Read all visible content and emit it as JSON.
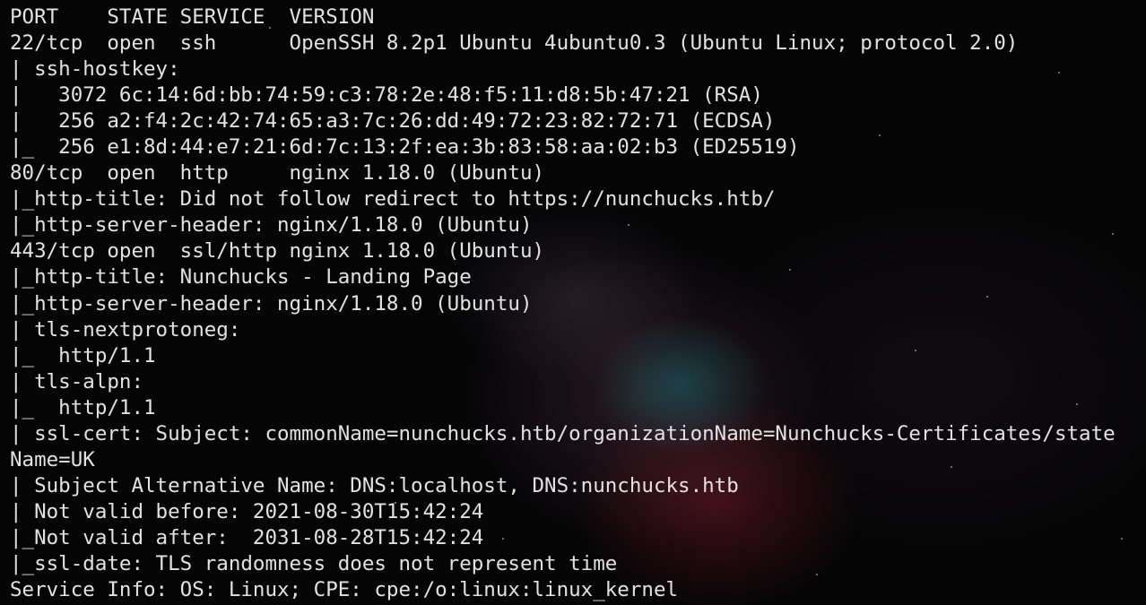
{
  "terminal": {
    "lines": [
      "PORT    STATE SERVICE  VERSION",
      "22/tcp  open  ssh      OpenSSH 8.2p1 Ubuntu 4ubuntu0.3 (Ubuntu Linux; protocol 2.0)",
      "| ssh-hostkey:",
      "|   3072 6c:14:6d:bb:74:59:c3:78:2e:48:f5:11:d8:5b:47:21 (RSA)",
      "|   256 a2:f4:2c:42:74:65:a3:7c:26:dd:49:72:23:82:72:71 (ECDSA)",
      "|_  256 e1:8d:44:e7:21:6d:7c:13:2f:ea:3b:83:58:aa:02:b3 (ED25519)",
      "80/tcp  open  http     nginx 1.18.0 (Ubuntu)",
      "|_http-title: Did not follow redirect to https://nunchucks.htb/",
      "|_http-server-header: nginx/1.18.0 (Ubuntu)",
      "443/tcp open  ssl/http nginx 1.18.0 (Ubuntu)",
      "|_http-title: Nunchucks - Landing Page",
      "|_http-server-header: nginx/1.18.0 (Ubuntu)",
      "| tls-nextprotoneg:",
      "|_  http/1.1",
      "| tls-alpn:",
      "|_  http/1.1",
      "| ssl-cert: Subject: commonName=nunchucks.htb/organizationName=Nunchucks-Certificates/state",
      "Name=UK",
      "| Subject Alternative Name: DNS:localhost, DNS:nunchucks.htb",
      "| Not valid before: 2021-08-30T15:42:24",
      "|_Not valid after:  2031-08-28T15:42:24",
      "|_ssl-date: TLS randomness does not represent time",
      "Service Info: OS: Linux; CPE: cpe:/o:linux:linux_kernel"
    ]
  }
}
